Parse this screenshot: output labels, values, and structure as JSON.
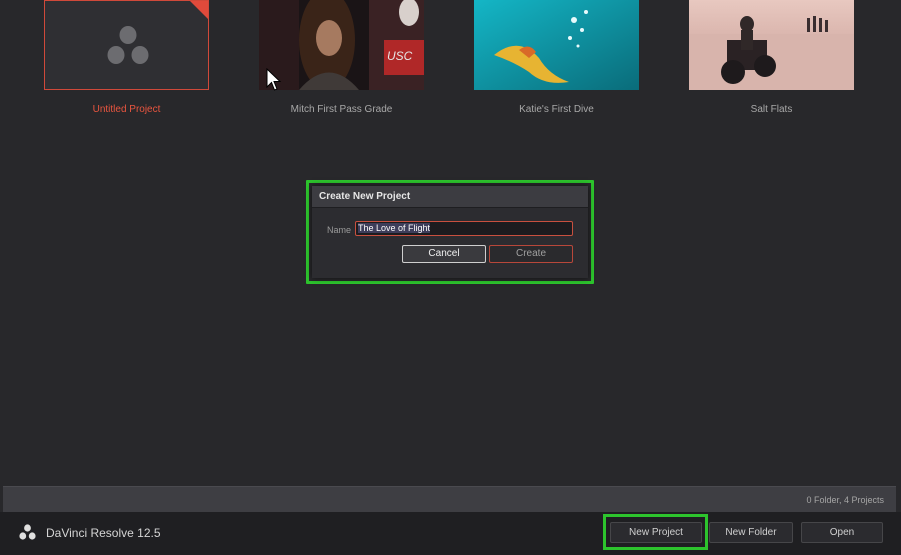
{
  "projects": [
    {
      "title": "Untitled Project",
      "selected": true
    },
    {
      "title": "Mitch First Pass Grade",
      "selected": false
    },
    {
      "title": "Katie's First Dive",
      "selected": false
    },
    {
      "title": "Salt Flats",
      "selected": false
    }
  ],
  "dialog": {
    "title": "Create New Project",
    "name_label": "Name",
    "name_value": "The Love of Flight",
    "cancel_label": "Cancel",
    "create_label": "Create"
  },
  "status": {
    "summary": "0 Folder, 4 Projects"
  },
  "footer": {
    "app_name": "DaVinci Resolve 12.5",
    "new_project_label": "New Project",
    "new_folder_label": "New Folder",
    "open_label": "Open"
  },
  "colors": {
    "accent_red": "#e8553f",
    "highlight_green": "#2dc42d",
    "background": "#28282b"
  },
  "icons": [
    "resolve-logo-icon",
    "cursor-icon"
  ]
}
